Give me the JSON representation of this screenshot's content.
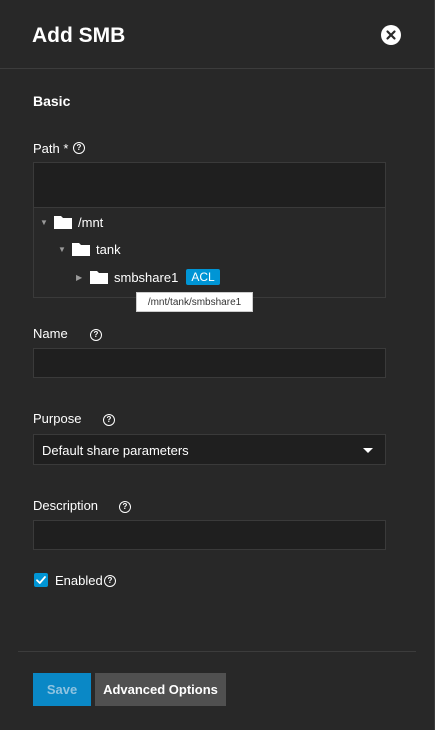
{
  "dialog": {
    "title": "Add SMB",
    "close_icon": "close-circle-icon"
  },
  "section": {
    "title": "Basic"
  },
  "path": {
    "label": "Path *",
    "value": "",
    "tree": [
      {
        "name": "/mnt",
        "expanded": true,
        "icon": "folder-icon"
      },
      {
        "name": "tank",
        "expanded": true,
        "icon": "folder-icon"
      },
      {
        "name": "smbshare1",
        "expanded": false,
        "icon": "folder-icon",
        "badge": "ACL"
      }
    ],
    "tooltip": "/mnt/tank/smbshare1"
  },
  "name": {
    "label": "Name",
    "value": ""
  },
  "purpose": {
    "label": "Purpose",
    "selected": "Default share parameters"
  },
  "description": {
    "label": "Description",
    "value": ""
  },
  "enabled": {
    "label": "Enabled",
    "checked": true
  },
  "footer": {
    "save_label": "Save",
    "advanced_label": "Advanced Options"
  },
  "colors": {
    "accent": "#0095d5",
    "panel_bg": "#282828",
    "input_bg": "#1f1f1f"
  }
}
